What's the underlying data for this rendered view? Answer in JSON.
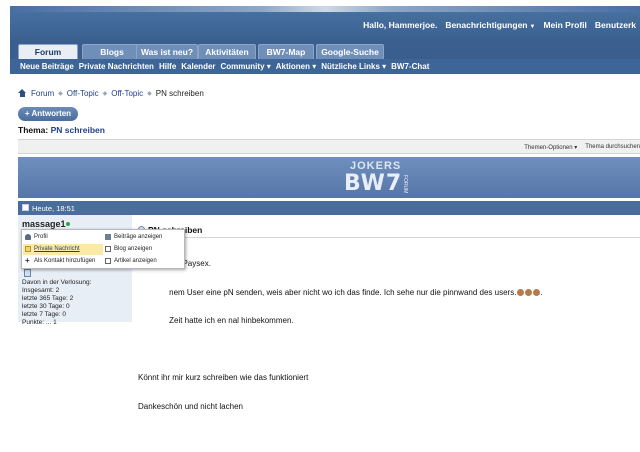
{
  "header": {
    "user_links": [
      {
        "label": "Hallo, Hammerjoe.",
        "dropdown": false
      },
      {
        "label": "Benachrichtigungen",
        "dropdown": true
      },
      {
        "label": "Mein Profil",
        "dropdown": false
      },
      {
        "label": "Benutzerk",
        "dropdown": false
      }
    ]
  },
  "tabs": [
    "Forum",
    "Blogs",
    "Was ist neu?",
    "Aktivitäten",
    "BW7-Map",
    "Google-Suche"
  ],
  "subnav": [
    "Neue Beiträge",
    "Private Nachrichten",
    "Hilfe",
    "Kalender",
    "Community ▾",
    "Aktionen ▾",
    "Nützliche Links ▾",
    "BW7-Chat"
  ],
  "breadcrumb": {
    "items": [
      "Forum",
      "Off-Topic",
      "Off-Topic"
    ],
    "current": "PN schreiben"
  },
  "reply_button": "+ Antworten",
  "thread": {
    "prefix": "Thema:",
    "title": "PN schreiben",
    "tools": [
      "Themen-Optionen ▾",
      "Thema durchsuchen"
    ]
  },
  "banner": {
    "logo_top": "JOKERS",
    "logo_main": "BW7",
    "logo_side": "FORUM"
  },
  "post": {
    "date": "Heute, 18:51",
    "username": "massage1",
    "user_stats": [
      "Davon in der Verlosung:",
      "Insgesamt: 2",
      "letzte 365 Tage: 2",
      "letzte 30 Tage: 0",
      "letzte 7 Tage: 0",
      "Punkte: ... 1"
    ],
    "title": "PN schreiben",
    "lines": [
      "              em Paysex.",
      "              nem User eine pN senden, weis aber nicht wo ich das finde. Ich sehe nur die pinnwand des users.",
      "              Zeit hatte ich en nal hinbekommen.",
      "",
      "Könnt ihr mir kurz schreiben wie das funktioniert",
      "Dankeschön und nicht lachen"
    ]
  },
  "user_popup": {
    "items": [
      {
        "label": "Profil",
        "icon": "person-icon"
      },
      {
        "label": "Beiträge anzeigen",
        "icon": "posts-icon"
      },
      {
        "label": "Private Nachricht",
        "icon": "mail-icon"
      },
      {
        "label": "Blog anzeigen",
        "icon": "blog-icon"
      },
      {
        "label": "Als Kontakt hinzufügen",
        "icon": "add-contact-icon"
      },
      {
        "label": "Artikel anzeigen",
        "icon": "article-icon"
      }
    ]
  }
}
